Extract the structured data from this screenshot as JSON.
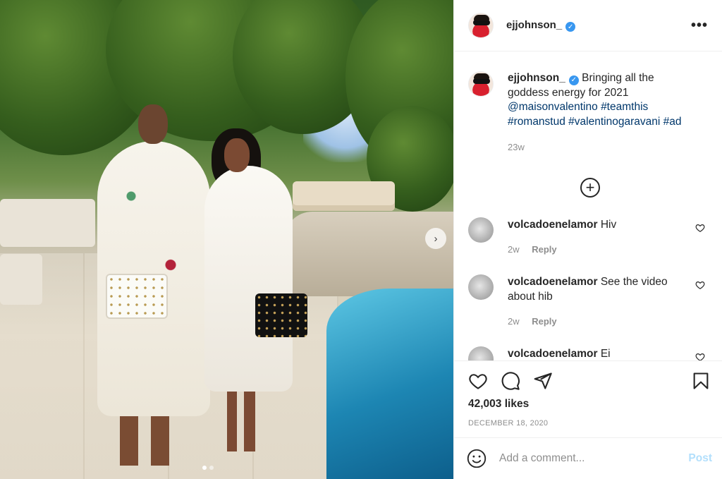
{
  "post": {
    "username": "ejjohnson_",
    "verified_mark": "✓",
    "more_label": "•••",
    "carousel_arrow": "›",
    "caption": {
      "text": "Bringing all the goddess energy for 2021",
      "mentions": [
        "@maisonvalentino",
        "#teamthis",
        "#romanstud",
        "#valentinogaravani",
        "#ad"
      ],
      "time": "23w"
    },
    "load_more_label": "+",
    "carousel": {
      "slides": 2,
      "active_index": 0
    }
  },
  "comments": [
    {
      "username": "volcadoenelamor",
      "text": "Hiv",
      "time": "2w",
      "reply_label": "Reply"
    },
    {
      "username": "volcadoenelamor",
      "text": "See the video about hib",
      "time": "2w",
      "reply_label": "Reply"
    },
    {
      "username": "volcadoenelamor",
      "text": "Ei",
      "time": "",
      "reply_label": ""
    }
  ],
  "actions": {
    "likes": "42,003 likes",
    "date": "DECEMBER 18, 2020"
  },
  "add_comment": {
    "placeholder": "Add a comment...",
    "post_label": "Post"
  },
  "colors": {
    "link": "#00376b",
    "verified": "#3897f0",
    "post_disabled": "#b2dffc",
    "muted": "#8e8e8e"
  },
  "icons": [
    "verified-icon",
    "more-options-icon",
    "load-more-icon",
    "heart-icon",
    "comment-icon",
    "share-icon",
    "bookmark-icon",
    "emoji-icon",
    "chevron-right-icon"
  ]
}
